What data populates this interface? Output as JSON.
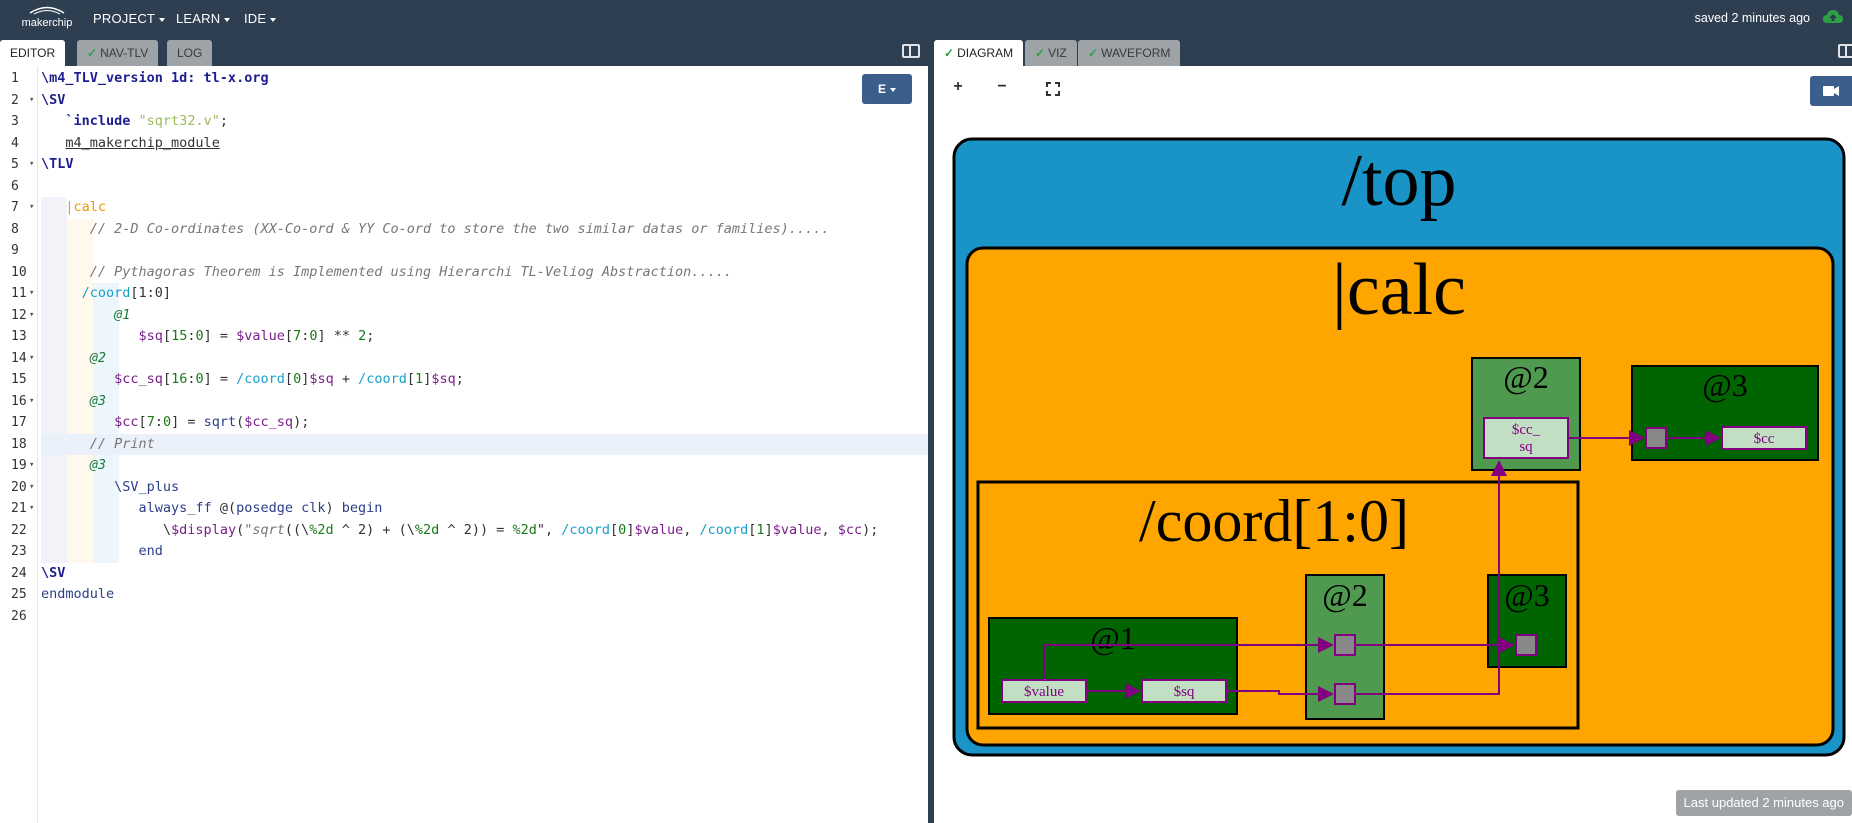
{
  "topbar": {
    "logo_text": "makerchip",
    "menus": [
      "PROJECT",
      "LEARN",
      "IDE"
    ],
    "saved_status": "saved 2 minutes ago"
  },
  "left_tabs": [
    {
      "label": "EDITOR",
      "active": true,
      "check": false
    },
    {
      "label": "NAV-TLV",
      "active": false,
      "check": true
    },
    {
      "label": "LOG",
      "active": false,
      "check": false
    }
  ],
  "right_tabs": [
    {
      "label": "DIAGRAM",
      "active": true,
      "check": true
    },
    {
      "label": "VIZ",
      "active": false,
      "check": true
    },
    {
      "label": "WAVEFORM",
      "active": false,
      "check": true
    }
  ],
  "editor": {
    "mode_button": "E",
    "highlighted_line": 18,
    "foldable_lines": [
      2,
      5,
      7,
      11,
      12,
      14,
      16,
      19,
      20,
      21
    ],
    "lines": [
      [
        [
          "kw",
          "\\m4_TLV_version 1d: tl-x.org"
        ]
      ],
      [
        [
          "kw",
          "\\SV"
        ]
      ],
      [
        [
          "plain",
          "   "
        ],
        [
          "kw",
          "`include "
        ],
        [
          "str",
          "\"sqrt32.v\""
        ],
        [
          "plain",
          ";"
        ]
      ],
      [
        [
          "plain",
          "   "
        ],
        [
          "u",
          "m4_makerchip_module"
        ]
      ],
      [
        [
          "kw",
          "\\TLV"
        ]
      ],
      [
        [
          "plain",
          ""
        ]
      ],
      [
        [
          "plain",
          "   "
        ],
        [
          "pipe",
          "|calc"
        ]
      ],
      [
        [
          "plain",
          "      "
        ],
        [
          "cmt",
          "// 2-D Co-ordinates (XX-Co-ord & YY Co-ord to store the two similar datas or families)....."
        ]
      ],
      [
        [
          "plain",
          ""
        ]
      ],
      [
        [
          "plain",
          "      "
        ],
        [
          "cmt",
          "// Pythagoras Theorem is Implemented using Hierarchi TL-Veliog Abstraction....."
        ]
      ],
      [
        [
          "plain",
          "     "
        ],
        [
          "scope",
          "/coord"
        ],
        [
          "plain",
          "[1:0]"
        ]
      ],
      [
        [
          "plain",
          "         "
        ],
        [
          "beh",
          "@1"
        ]
      ],
      [
        [
          "plain",
          "            "
        ],
        [
          "sig",
          "$sq"
        ],
        [
          "plain",
          "["
        ],
        [
          "num",
          "15"
        ],
        [
          "plain",
          ":"
        ],
        [
          "num",
          "0"
        ],
        [
          "plain",
          "] = "
        ],
        [
          "sig",
          "$value"
        ],
        [
          "plain",
          "["
        ],
        [
          "num",
          "7"
        ],
        [
          "plain",
          ":"
        ],
        [
          "num",
          "0"
        ],
        [
          "plain",
          "] ** "
        ],
        [
          "num",
          "2"
        ],
        [
          "plain",
          ";"
        ]
      ],
      [
        [
          "plain",
          "      "
        ],
        [
          "beh",
          "@2"
        ]
      ],
      [
        [
          "plain",
          "         "
        ],
        [
          "sig",
          "$cc_sq"
        ],
        [
          "plain",
          "["
        ],
        [
          "num",
          "16"
        ],
        [
          "plain",
          ":"
        ],
        [
          "num",
          "0"
        ],
        [
          "plain",
          "] = "
        ],
        [
          "scope",
          "/coord"
        ],
        [
          "plain",
          "["
        ],
        [
          "num",
          "0"
        ],
        [
          "plain",
          "]"
        ],
        [
          "sig",
          "$sq"
        ],
        [
          "plain",
          " + "
        ],
        [
          "scope",
          "/coord"
        ],
        [
          "plain",
          "["
        ],
        [
          "num",
          "1"
        ],
        [
          "plain",
          "]"
        ],
        [
          "sig",
          "$sq"
        ],
        [
          "plain",
          ";"
        ]
      ],
      [
        [
          "plain",
          "      "
        ],
        [
          "beh",
          "@3"
        ]
      ],
      [
        [
          "plain",
          "         "
        ],
        [
          "sig",
          "$cc"
        ],
        [
          "plain",
          "["
        ],
        [
          "num",
          "7"
        ],
        [
          "plain",
          ":"
        ],
        [
          "num",
          "0"
        ],
        [
          "plain",
          "] = "
        ],
        [
          "fn",
          "sqrt"
        ],
        [
          "plain",
          "("
        ],
        [
          "sig",
          "$cc_sq"
        ],
        [
          "plain",
          ");"
        ]
      ],
      [
        [
          "plain",
          "      "
        ],
        [
          "cmt",
          "// Print"
        ]
      ],
      [
        [
          "plain",
          "      "
        ],
        [
          "beh",
          "@3"
        ]
      ],
      [
        [
          "plain",
          "         "
        ],
        [
          "fn",
          "\\SV_plus"
        ]
      ],
      [
        [
          "plain",
          "            "
        ],
        [
          "fn",
          "always_ff"
        ],
        [
          "plain",
          " @("
        ],
        [
          "fn",
          "posedge clk"
        ],
        [
          "plain",
          ") "
        ],
        [
          "fn",
          "begin"
        ]
      ],
      [
        [
          "plain",
          "               \\"
        ],
        [
          "sig",
          "$display"
        ],
        [
          "plain",
          "("
        ],
        [
          "cmt",
          "\"sqrt"
        ],
        [
          "plain",
          "((\\"
        ],
        [
          "num",
          "%2d"
        ],
        [
          "plain",
          " ^ 2) + (\\"
        ],
        [
          "num",
          "%2d"
        ],
        [
          "plain",
          " ^ 2)) = "
        ],
        [
          "num",
          "%2d"
        ],
        [
          "plain",
          "\", "
        ],
        [
          "scope",
          "/coord"
        ],
        [
          "plain",
          "["
        ],
        [
          "num",
          "0"
        ],
        [
          "plain",
          "]"
        ],
        [
          "sig",
          "$value"
        ],
        [
          "plain",
          ", "
        ],
        [
          "scope",
          "/coord"
        ],
        [
          "plain",
          "["
        ],
        [
          "num",
          "1"
        ],
        [
          "plain",
          "]"
        ],
        [
          "sig",
          "$value"
        ],
        [
          "plain",
          ", "
        ],
        [
          "sig",
          "$cc"
        ],
        [
          "plain",
          ");"
        ]
      ],
      [
        [
          "plain",
          "            "
        ],
        [
          "fn",
          "end"
        ]
      ],
      [
        [
          "kw",
          "\\SV"
        ]
      ],
      [
        [
          "fn",
          "endmodule"
        ]
      ],
      [
        [
          "plain",
          ""
        ]
      ]
    ]
  },
  "diagram": {
    "zoom_in": "+",
    "zoom_out": "−",
    "fit_icon": "fullscreen-icon",
    "top_label": "/top",
    "calc_label": "|calc",
    "coord_label": "/coord[1:0]",
    "stage_labels": {
      "calc_at2": "@2",
      "calc_at3": "@3",
      "coord_at1": "@1",
      "coord_at2": "@2",
      "coord_at3": "@3"
    },
    "signals": {
      "cc_sq": "$cc_\nsq",
      "cc": "$cc",
      "value": "$value",
      "sq": "$sq"
    },
    "colors": {
      "top": "#1a93c7",
      "calc": "#ffa500",
      "stage_dark": "#006400",
      "stage_light": "#4f9a4f",
      "signal": "#c3dfc3",
      "wire": "#800080"
    },
    "last_updated": "Last updated 2 minutes ago"
  }
}
